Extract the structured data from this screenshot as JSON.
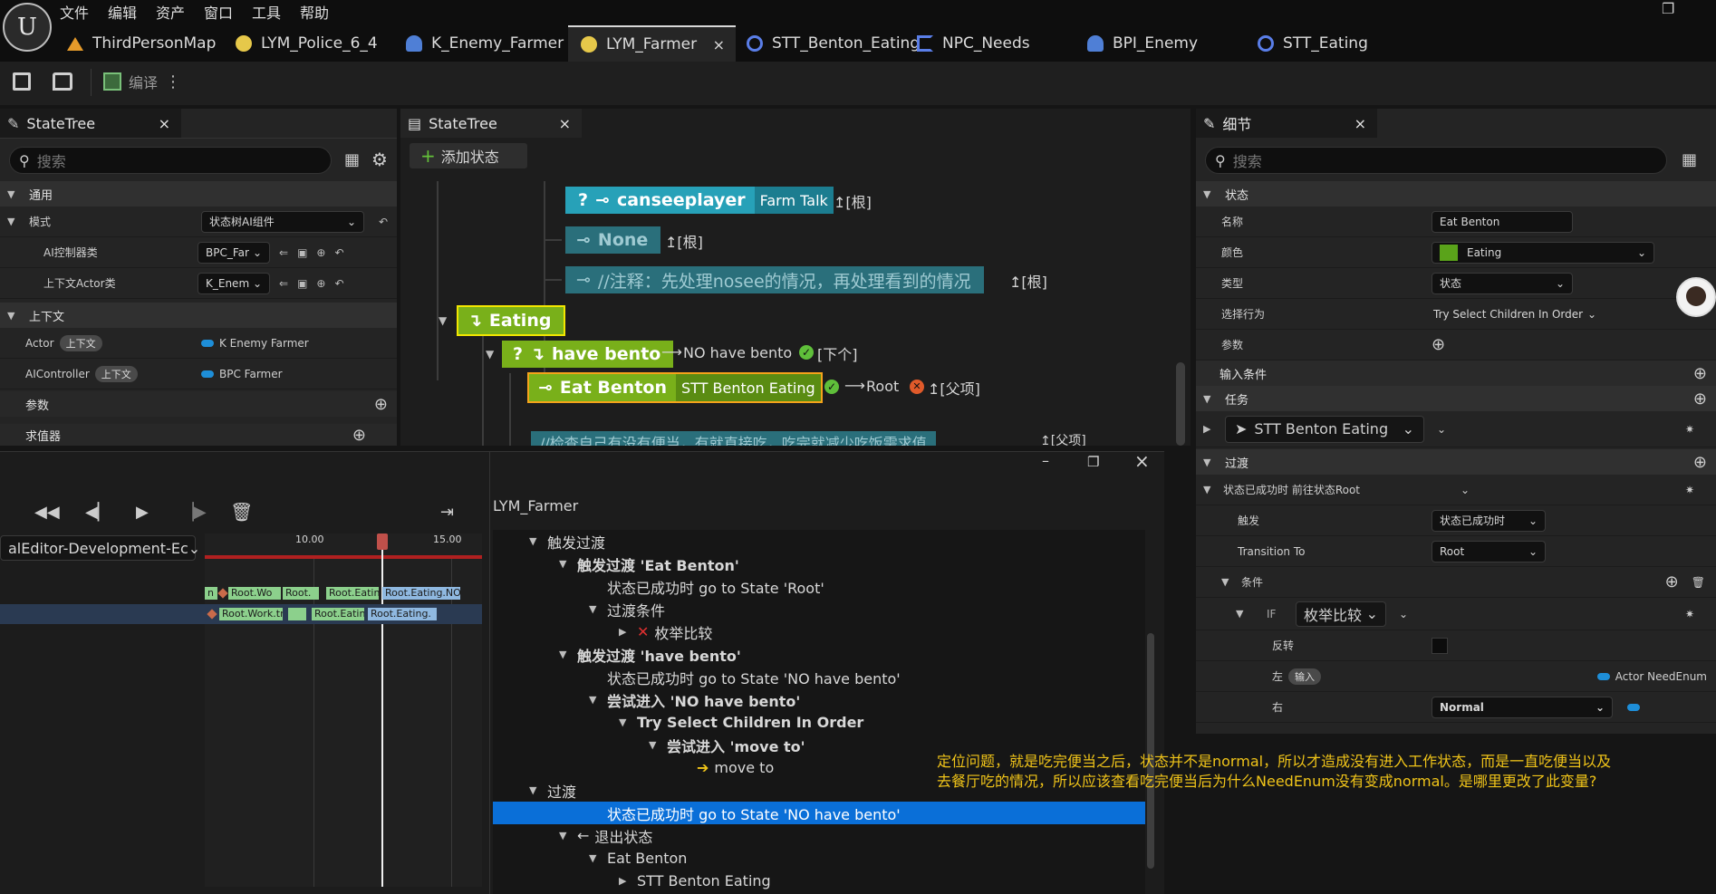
{
  "app": {
    "menu": [
      "文件",
      "编辑",
      "资产",
      "窗口",
      "工具",
      "帮助"
    ],
    "tabs": [
      {
        "label": "ThirdPersonMap",
        "icon": "level-icon"
      },
      {
        "label": "LYM_Police_6_4",
        "icon": "statetree-icon"
      },
      {
        "label": "K_Enemy_Farmer",
        "icon": "character-icon"
      },
      {
        "label": "LYM_Farmer",
        "icon": "statetree-icon",
        "active": true
      },
      {
        "label": "STT_Benton_Eating",
        "icon": "task-icon"
      },
      {
        "label": "NPC_Needs",
        "icon": "enum-icon"
      },
      {
        "label": "BPI_Enemy",
        "icon": "interface-icon"
      },
      {
        "label": "STT_Eating",
        "icon": "task-icon"
      }
    ],
    "close_glyph": "×",
    "window_controls": {
      "minimize": "–",
      "maximize": "❐"
    }
  },
  "toolbar": {
    "compile_label": "编译"
  },
  "left_panel": {
    "tab_title": "StateTree",
    "search_placeholder": "搜索",
    "section_general": "通用",
    "schema_label": "模式",
    "schema_value": "状态树AI组件",
    "ai_controller_class_label": "AI控制器类",
    "ai_controller_class_value": "BPC_Far",
    "context_actor_class_label": "上下文Actor类",
    "context_actor_class_value": "K_Enem",
    "section_context": "上下文",
    "context_rows": [
      {
        "name": "Actor",
        "tag": "上下文",
        "value": "K Enemy Farmer"
      },
      {
        "name": "AIController",
        "tag": "上下文",
        "value": "BPC Farmer"
      }
    ],
    "params_label": "参数",
    "evaluators_label": "求值器"
  },
  "center_panel": {
    "tab_title": "StateTree",
    "add_state_label": "添加状态",
    "nodes": {
      "canseeplayer": {
        "prefix": "?",
        "label": "canseeplayer",
        "task": "Farm Talk",
        "transition": "↥[根]"
      },
      "none_node": {
        "label": "None",
        "transition": "↥[根]"
      },
      "comment1": {
        "label": "//注释：先处理nosee的情况，再处理看到的情况",
        "transition": "↥[根]"
      },
      "eating": {
        "label": "Eating"
      },
      "have_bento": {
        "prefix": "?",
        "label": "have bento",
        "transition_target": "NO have bento",
        "transition": "[下个]"
      },
      "eat_benton": {
        "label": "Eat Benton",
        "task": "STT Benton Eating",
        "transition_target": "Root",
        "transition": "↥[父项]"
      },
      "comment2": {
        "label": "//检查自己有没有便当，有就直接吃，吃完就减少吃饭需求值",
        "transition": "↥[父项]"
      }
    }
  },
  "debugger": {
    "target_label": "alEditor-Development-Ec",
    "asset_title": "LYM_Farmer",
    "timeline_ticks": [
      "10.00",
      "15.00"
    ],
    "track1": [
      "n",
      "Root.Wo",
      "Root.",
      "Root.Eatin",
      "Root.Eating.NO"
    ],
    "track2": [
      "Root.Work.tr",
      "Root.Eatin",
      "Root.Eating."
    ],
    "tree": [
      {
        "indent": 0,
        "caret": "▼",
        "text": "触发过渡",
        "bold": false
      },
      {
        "indent": 1,
        "caret": "▼",
        "text": "触发过渡 'Eat Benton'",
        "bold": true
      },
      {
        "indent": 2,
        "caret": "",
        "text": "状态已成功时 go to State 'Root'",
        "bold": false
      },
      {
        "indent": 2,
        "caret": "▼",
        "text": "过渡条件",
        "bold": false
      },
      {
        "indent": 3,
        "caret": "▶",
        "text": "枚举比较",
        "bold": false,
        "x_icon": true
      },
      {
        "indent": 1,
        "caret": "▼",
        "text": "触发过渡 'have bento'",
        "bold": true
      },
      {
        "indent": 2,
        "caret": "",
        "text": "状态已成功时 go to State 'NO have bento'",
        "bold": false
      },
      {
        "indent": 2,
        "caret": "▼",
        "text": "尝试进入 'NO have bento'",
        "bold": true
      },
      {
        "indent": 3,
        "caret": "▼",
        "text": "Try Select Children In Order",
        "bold": true
      },
      {
        "indent": 4,
        "caret": "▼",
        "text": "尝试进入 'move to'",
        "bold": true
      },
      {
        "indent": 5,
        "caret": "",
        "text": "move to",
        "bold": false,
        "arrow": true
      },
      {
        "indent": 0,
        "caret": "▼",
        "text": "过渡",
        "bold": false
      },
      {
        "indent": 2,
        "caret": "",
        "text": "状态已成功时 go to State 'NO have bento'",
        "bold": false,
        "selected": true
      },
      {
        "indent": 1,
        "caret": "▼",
        "text": "退出状态",
        "bold": false,
        "exit": true
      },
      {
        "indent": 2,
        "caret": "▼",
        "text": "Eat Benton",
        "bold": false
      },
      {
        "indent": 3,
        "caret": "▶",
        "text": "STT Benton Eating",
        "bold": false
      }
    ]
  },
  "details": {
    "tab_title": "细节",
    "search_placeholder": "搜索",
    "section_state": "状态",
    "name_label": "名称",
    "name_value": "Eat Benton",
    "color_label": "颜色",
    "color_value": "Eating",
    "color_swatch": "#5aa31a",
    "type_label": "类型",
    "type_value": "状态",
    "selection_label": "选择行为",
    "selection_value": "Try Select Children In Order",
    "params_label": "参数",
    "enter_conditions_label": "输入条件",
    "section_tasks": "任务",
    "task_value": "STT Benton Eating",
    "section_transitions": "过渡",
    "transition_header": "状态已成功时 前往状态Root",
    "trigger_label": "触发",
    "trigger_value": "状态已成功时",
    "transition_to_label": "Transition To",
    "transition_to_value": "Root",
    "conditions_label": "条件",
    "if_label": "IF",
    "condition_value": "枚举比较",
    "invert_label": "反转",
    "left_label": "左",
    "left_tag": "输入",
    "left_value": "Actor NeedEnum",
    "right_label": "右",
    "right_value": "Normal"
  },
  "annotation": {
    "line1": "定位问题，就是吃完便当之后，状态并不是normal，所以才造成没有进入工作状态，而是一直吃便当以及",
    "line2": "去餐厅吃的情况，所以应该查看吃完便当后为什么NeedEnum没有变成normal。是哪里更改了此变量?"
  }
}
